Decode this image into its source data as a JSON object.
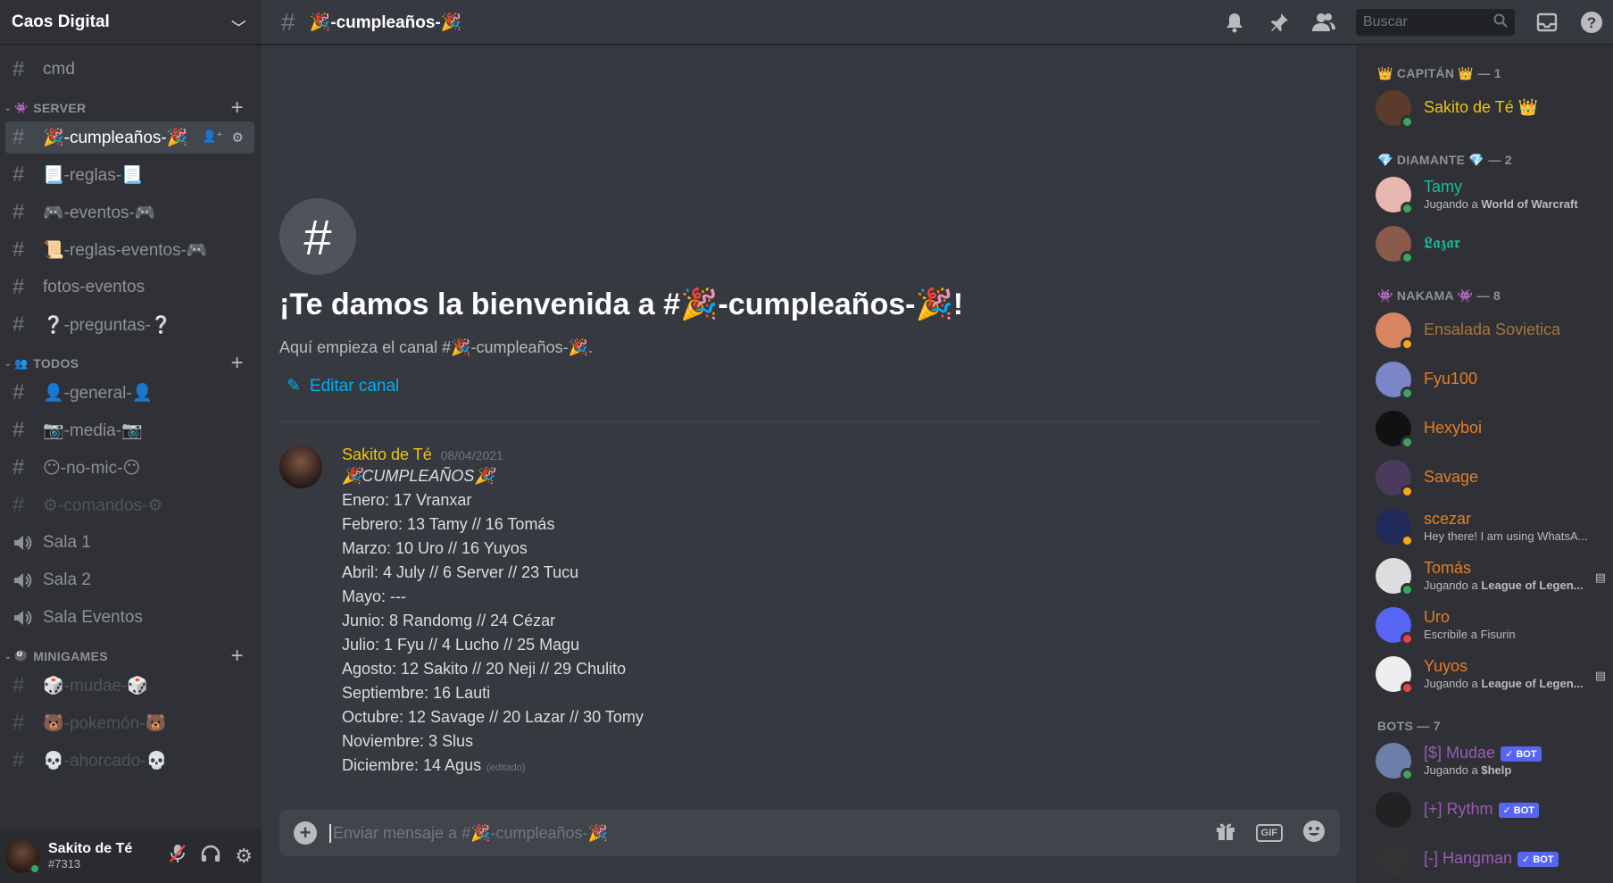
{
  "server": {
    "name": "Caos Digital"
  },
  "channels_top": [
    {
      "name": "cmd"
    }
  ],
  "categories": [
    {
      "name": "SERVER",
      "icon": "👾",
      "channels": [
        {
          "name": "🎉-cumpleaños-🎉",
          "type": "text",
          "active": true
        },
        {
          "name": "📃-reglas-📃",
          "type": "text"
        },
        {
          "name": "🎮-eventos-🎮",
          "type": "text"
        },
        {
          "name": "📜-reglas-eventos-🎮",
          "type": "text"
        },
        {
          "name": "fotos-eventos",
          "type": "text"
        },
        {
          "name": "❔-preguntas-❔",
          "type": "text"
        }
      ]
    },
    {
      "name": "TODOS",
      "icon": "👥",
      "channels": [
        {
          "name": "👤-general-👤",
          "type": "text"
        },
        {
          "name": "📷-media-📷",
          "type": "text"
        },
        {
          "name": "😶-no-mic-😶",
          "type": "text"
        },
        {
          "name": "⚙-comandos-⚙",
          "type": "text",
          "muted": true
        },
        {
          "name": "Sala 1",
          "type": "voice"
        },
        {
          "name": "Sala 2",
          "type": "voice"
        },
        {
          "name": "Sala Eventos",
          "type": "voice"
        }
      ]
    },
    {
      "name": "MINIGAMES",
      "icon": "🎱",
      "channels": [
        {
          "name": "🎲-mudae-🎲",
          "type": "text",
          "muted": true
        },
        {
          "name": "🐻-pokemón-🐻",
          "type": "text",
          "muted": true
        },
        {
          "name": "💀-ahorcado-💀",
          "type": "text",
          "muted": true
        }
      ]
    }
  ],
  "user": {
    "name": "Sakito de Té",
    "tag": "#7313"
  },
  "topbar": {
    "channel": "🎉-cumpleaños-🎉",
    "search_placeholder": "Buscar"
  },
  "welcome": {
    "title": "¡Te damos la bienvenida a #🎉-cumpleaños-🎉!",
    "subtitle": "Aquí empieza el canal #🎉-cumpleaños-🎉.",
    "edit": "Editar canal"
  },
  "message": {
    "author": "Sakito de Té",
    "timestamp": "08/04/2021",
    "title": "🎉CUMPLEAÑOS🎉",
    "lines": [
      "Enero: 17 Vranxar",
      "Febrero: 13 Tamy // 16 Tomás",
      "Marzo: 10 Uro // 16 Yuyos",
      "Abril: 4 July // 6 Server // 23 Tucu",
      "Mayo: ---",
      "Junio: 8 Randomg // 24 Cézar",
      "Julio: 1 Fyu // 4 Lucho // 25 Magu",
      "Agosto: 12 Sakito // 20 Neji //  29 Chulito",
      "Septiembre: 16 Lauti",
      "Octubre: 12 Savage // 20 Lazar // 30 Tomy",
      "Noviembre: 3 Slus",
      "Diciembre: 14 Agus"
    ],
    "edited": "(editado)"
  },
  "composer": {
    "placeholder": "Enviar mensaje a #🎉-cumpleaños-🎉",
    "gif": "GIF"
  },
  "members": {
    "roles": [
      {
        "title": "👑 CAPITÁN 👑 — 1",
        "members": [
          {
            "name": "Sakito de Té 👑",
            "color": "#f1c40f",
            "status": "online"
          }
        ]
      },
      {
        "title": "💎 DIAMANTE 💎 — 2",
        "members": [
          {
            "name": "Tamy",
            "color": "#1abc9c",
            "status": "online",
            "activity_prefix": "Jugando a ",
            "activity": "World of Warcraft"
          },
          {
            "name": "𝕷𝖆𝖟𝖆𝖗",
            "color": "#1abc9c",
            "status": "online"
          }
        ]
      },
      {
        "title": "👾 NAKAMA 👾 — 8",
        "members": [
          {
            "name": "Ensalada Sovietica",
            "color": "#a8743c",
            "status": "idle"
          },
          {
            "name": "Fyu100",
            "color": "#e67e22",
            "status": "mobile"
          },
          {
            "name": "Hexyboi",
            "color": "#e67e22",
            "status": "online"
          },
          {
            "name": "Savage",
            "color": "#e67e22",
            "status": "idle"
          },
          {
            "name": "scezar",
            "color": "#e67e22",
            "status": "idle",
            "activity": "Hey there! I am using WhatsA..."
          },
          {
            "name": "Tomás",
            "color": "#e67e22",
            "status": "online",
            "activity_prefix": "Jugando a ",
            "activity": "League of Legen...",
            "rich": true
          },
          {
            "name": "Uro",
            "color": "#e67e22",
            "status": "dnd",
            "activity": "Escribile a Fisurin"
          },
          {
            "name": "Yuyos",
            "color": "#e67e22",
            "status": "dnd",
            "activity_prefix": "Jugando a ",
            "activity": "League of Legen...",
            "rich": true
          }
        ]
      },
      {
        "title": "BOTS — 7",
        "members": [
          {
            "name": "[$] Mudae",
            "color": "#9b59b6",
            "status": "online",
            "bot": "✓ BOT",
            "activity_prefix": "Jugando a ",
            "activity": "$help"
          },
          {
            "name": "[+] Rythm",
            "color": "#9b59b6",
            "status": "none",
            "bot": "✓ BOT"
          },
          {
            "name": "[-] Hangman",
            "color": "#9b59b6",
            "status": "none",
            "bot": "✓ BOT"
          }
        ]
      }
    ]
  },
  "colors": {
    "online": "#3ba55d",
    "idle": "#faa81a",
    "dnd": "#ed4245",
    "mobile": "#3ba55d"
  }
}
